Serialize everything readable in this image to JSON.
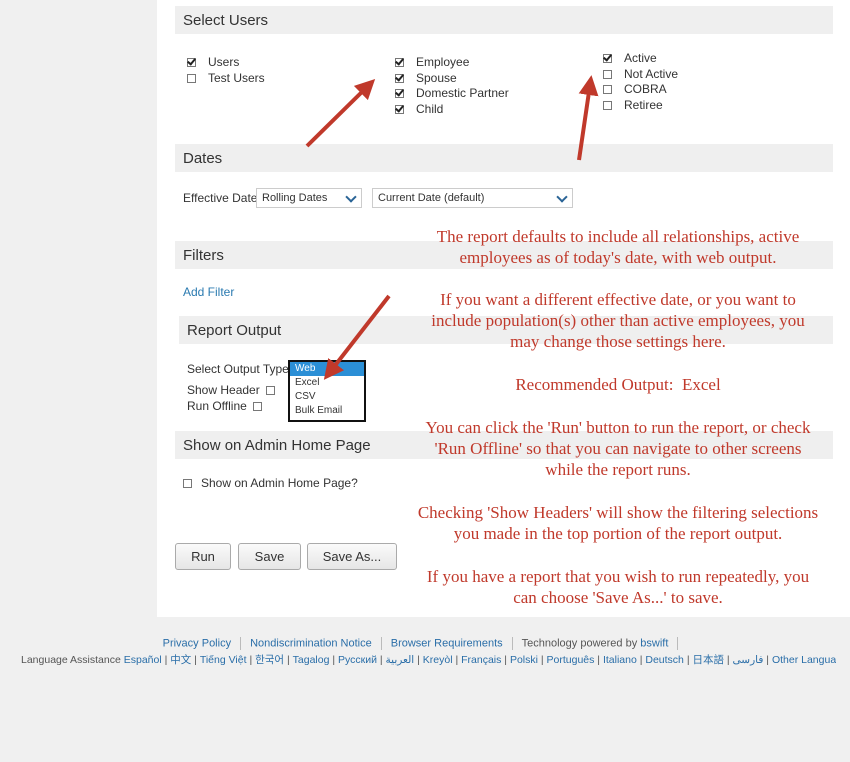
{
  "sections": {
    "select_users": "Select Users",
    "dates": "Dates",
    "filters": "Filters",
    "report_output": "Report Output",
    "admin_home": "Show on Admin Home Page"
  },
  "user_types": [
    {
      "label": "Users",
      "checked": true
    },
    {
      "label": "Test Users",
      "checked": false
    }
  ],
  "relationships": [
    {
      "label": "Employee",
      "checked": true
    },
    {
      "label": "Spouse",
      "checked": true
    },
    {
      "label": "Domestic Partner",
      "checked": true
    },
    {
      "label": "Child",
      "checked": true
    }
  ],
  "statuses": [
    {
      "label": "Active",
      "checked": true
    },
    {
      "label": "Not Active",
      "checked": false
    },
    {
      "label": "COBRA",
      "checked": false
    },
    {
      "label": "Retiree",
      "checked": false
    }
  ],
  "dates": {
    "effective_date_label": "Effective Date",
    "mode_value": "Rolling Dates",
    "date_value": "Current Date (default)"
  },
  "filters": {
    "add_filter": "Add Filter"
  },
  "report_output": {
    "select_output_type_label": "Select Output Type",
    "show_header_label": "Show Header",
    "run_offline_label": "Run Offline",
    "options": [
      "Web",
      "Excel",
      "CSV",
      "Bulk Email"
    ],
    "selected": "Web"
  },
  "admin_home": {
    "checkbox_label": "Show on Admin Home Page?"
  },
  "buttons": {
    "run": "Run",
    "save": "Save",
    "save_as": "Save As..."
  },
  "annotations": {
    "note1_line1": "The report defaults to include all relationships, active",
    "note1_line2": "employees as of today's date, with web output.",
    "note2_line1": "If you want a different effective date, or you want to",
    "note2_line2": "include population(s) other than active employees, you",
    "note2_line3": "may change those settings here.",
    "note3": "Recommended Output:  Excel",
    "note4_line1": "You can click the 'Run' button to run the report, or check",
    "note4_line2": "'Run Offline' so that you can navigate to other screens",
    "note4_line3": "while the report runs.",
    "note5_line1": "Checking 'Show Headers' will show the filtering selections",
    "note5_line2": "you made in the top portion of the report output.",
    "note6_line1": "If you have a report that you wish to run repeatedly, you",
    "note6_line2": "can choose 'Save As...' to save."
  },
  "footer": {
    "privacy": "Privacy Policy",
    "nondiscrimination": "Nondiscrimination Notice",
    "browser": "Browser Requirements",
    "powered_text": "Technology powered by",
    "powered_brand": "bswift",
    "language_assistance": "Language Assistance",
    "languages": [
      "Español",
      "中文",
      "Tiếng Việt",
      "한국어",
      "Tagalog",
      "Русский",
      "العربية",
      "Kreyòl",
      "Français",
      "Polski",
      "Português",
      "Italiano",
      "Deutsch",
      "日本語",
      "فارسی",
      "Other Languages..."
    ]
  },
  "colors": {
    "annotation": "#c0392b",
    "link": "#2a7ab0",
    "selected_option": "#2b8fd6"
  }
}
